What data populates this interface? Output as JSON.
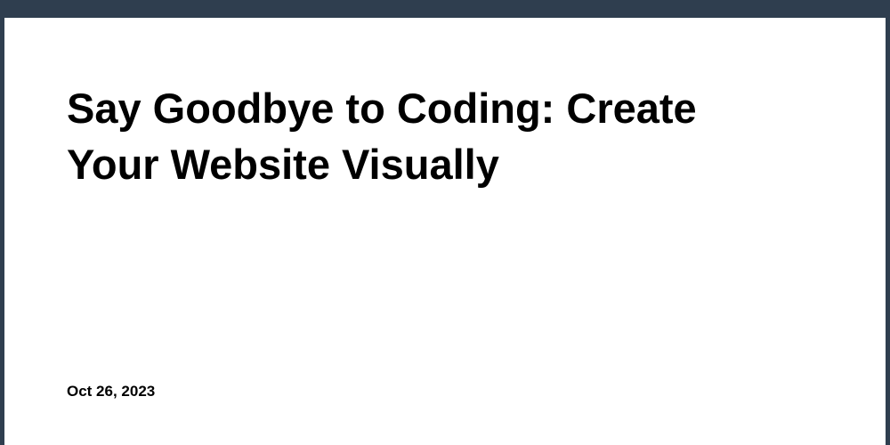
{
  "article": {
    "title": "Say Goodbye to Coding: Create Your Website Visually",
    "date": "Oct 26, 2023"
  }
}
